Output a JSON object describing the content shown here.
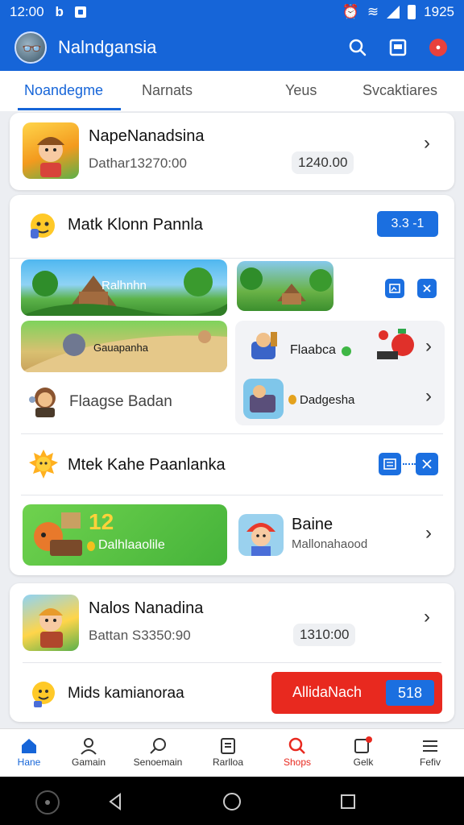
{
  "status": {
    "time": "12:00",
    "right_time": "1925",
    "notif_a": "b"
  },
  "app": {
    "title": "Nalndgansia",
    "badge": "●"
  },
  "tabs": [
    {
      "label": "Noandegme",
      "active": true
    },
    {
      "label": "Narnats"
    },
    {
      "label": "Yeus"
    },
    {
      "label": "Svcaktiares"
    }
  ],
  "card1": {
    "title": "NapeNanadsina",
    "subtitle": "Dathar13270:00",
    "price": "1240.00"
  },
  "section1": {
    "title": "Matk Klonn Pannla",
    "button": "3.3 -1",
    "banner1": "Ralhnhn",
    "banner2": "Gauapanha",
    "row1_label": "Flaagse Badan",
    "item_a": "Flaabca",
    "item_b": "Dadgesha"
  },
  "section2": {
    "title": "Mtek Kahe Paanlanka",
    "banner_big": "12",
    "banner_small": "Dalhlaaolile",
    "item_title": "Baine",
    "item_sub": "Mallonahaood"
  },
  "card3": {
    "title": "Nalos Nanadina",
    "subtitle": "Battan S3350:90",
    "price": "1310:00",
    "row2_label": "Mids kamianoraa",
    "red_button": "AllidaNach",
    "red_value": "518"
  },
  "bottom_nav": [
    {
      "label": "Hane",
      "active": true
    },
    {
      "label": "Gamain"
    },
    {
      "label": "Senoemain"
    },
    {
      "label": "Rarlloa"
    },
    {
      "label": "Shops",
      "red": true
    },
    {
      "label": "Gelk"
    },
    {
      "label": "Fefiv"
    }
  ],
  "colors": {
    "primary": "#1665d8",
    "red": "#e8291f",
    "green": "#58c23a"
  }
}
